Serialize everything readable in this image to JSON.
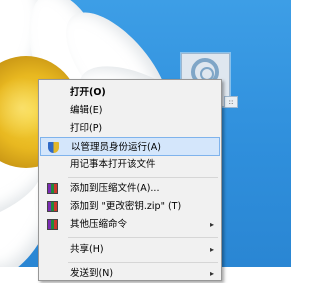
{
  "context_menu": {
    "items": [
      {
        "label": "打开(O)",
        "bold": true
      },
      {
        "label": "编辑(E)"
      },
      {
        "label": "打印(P)"
      },
      {
        "label": "以管理员身份运行(A)",
        "icon": "uac-shield-icon",
        "highlighted": true
      },
      {
        "label": "用记事本打开该文件"
      },
      {
        "label": "添加到压缩文件(A)...",
        "icon": "winrar-icon"
      },
      {
        "label": "添加到 \"更改密钥.zip\" (T)",
        "icon": "winrar-icon"
      },
      {
        "label": "其他压缩命令",
        "icon": "winrar-icon",
        "submenu": true
      },
      {
        "label": "共享(H)",
        "submenu": true
      },
      {
        "label": "发送到(N)",
        "submenu": true
      }
    ]
  },
  "icons": {
    "submenu_arrow": "▸"
  }
}
